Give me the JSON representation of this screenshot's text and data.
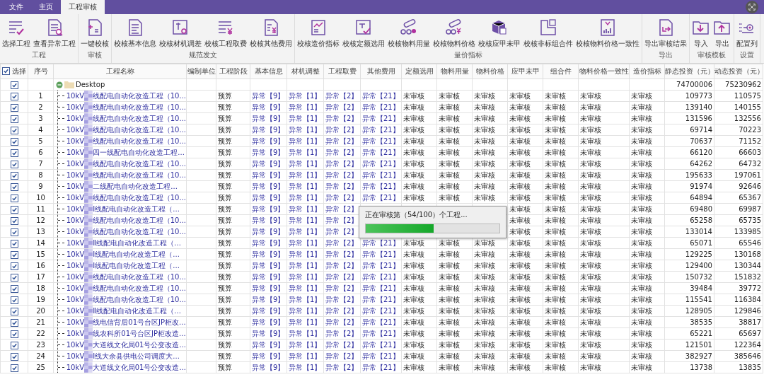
{
  "tabs": [
    {
      "label": "文件",
      "selected": false
    },
    {
      "label": "主页",
      "selected": false
    },
    {
      "label": "工程审核",
      "selected": true
    }
  ],
  "ribbon_groups": [
    {
      "label": "工程",
      "buttons": [
        "选择工程",
        "查看异常工程"
      ]
    },
    {
      "label": "审核",
      "buttons": [
        "一键校核"
      ]
    },
    {
      "label": "规范发文",
      "buttons": [
        "校核基本信息",
        "校核材机调差",
        "校核工程取费",
        "校核其他费用"
      ]
    },
    {
      "label": "量价指标",
      "buttons": [
        "校核造价指标",
        "校核定额选用",
        "校核物料用量",
        "校核物料价格",
        "校核应甲未甲",
        "校核非标组合件",
        "校核物料价格一致性"
      ]
    },
    {
      "label": "导出",
      "buttons": [
        "导出审核结果"
      ]
    },
    {
      "label": "审核模板",
      "buttons": [
        "导入",
        "导出"
      ]
    },
    {
      "label": "设置",
      "buttons": [
        "配置列"
      ]
    }
  ],
  "table": {
    "select_all": {
      "label": "选择",
      "checked": true
    },
    "columns": [
      "序号",
      "工程名称",
      "编制单位",
      "工程阶段",
      "基本信息",
      "材机调整",
      "工程取费",
      "其他费用",
      "定额选用",
      "物料用量",
      "物料价格",
      "应甲未甲",
      "组合件",
      "物料价格一致性",
      "造价指标",
      "静态投资（元）",
      "动态投资（元）"
    ],
    "root": {
      "name": "Desktop",
      "checked": true,
      "expanded": true,
      "static": "74700006",
      "dynamic": "75230962"
    },
    "rows": [
      {
        "no": "1",
        "checked": true,
        "name_start": "10kV",
        "name_rest": "线配电自动化改造工程（10...",
        "stage": "预算",
        "basic_info": "异常【9】",
        "material_adjust": "异常【1】",
        "fee": "异常【2】",
        "other_fees": "异常【21】",
        "quota": "未审核",
        "material_qty": "未审核",
        "material_price": "未审核",
        "supply": "未审核",
        "assembly": "未审核",
        "price_consistency": "未审核",
        "cost_index": "未审核",
        "static": "109773",
        "dynamic": "110575"
      },
      {
        "no": "2",
        "checked": true,
        "name_start": "10kV",
        "name_rest": "线配电自动化改造工程（10...",
        "stage": "预算",
        "basic_info": "异常【9】",
        "material_adjust": "异常【1】",
        "fee": "异常【2】",
        "other_fees": "异常【21】",
        "quota": "未审核",
        "material_qty": "未审核",
        "material_price": "未审核",
        "supply": "未审核",
        "assembly": "未审核",
        "price_consistency": "未审核",
        "cost_index": "未审核",
        "static": "139140",
        "dynamic": "140155"
      },
      {
        "no": "3",
        "checked": true,
        "name_start": "10kV",
        "name_rest": "线配电自动化改造工程（10...",
        "stage": "预算",
        "basic_info": "异常【9】",
        "material_adjust": "异常【1】",
        "fee": "异常【2】",
        "other_fees": "异常【21】",
        "quota": "未审核",
        "material_qty": "未审核",
        "material_price": "未审核",
        "supply": "未审核",
        "assembly": "未审核",
        "price_consistency": "未审核",
        "cost_index": "未审核",
        "static": "131596",
        "dynamic": "132556"
      },
      {
        "no": "4",
        "checked": true,
        "name_start": "10kV",
        "name_rest": "线配电自动化改造工程（10...",
        "stage": "预算",
        "basic_info": "异常【9】",
        "material_adjust": "异常【1】",
        "fee": "异常【2】",
        "other_fees": "异常【21】",
        "quota": "未审核",
        "material_qty": "未审核",
        "material_price": "未审核",
        "supply": "未审核",
        "assembly": "未审核",
        "price_consistency": "未审核",
        "cost_index": "未审核",
        "static": "69714",
        "dynamic": "70223"
      },
      {
        "no": "5",
        "checked": true,
        "name_start": "10kV",
        "name_rest": "线配电自动化改造工程（10...",
        "stage": "预算",
        "basic_info": "异常【9】",
        "material_adjust": "异常【1】",
        "fee": "异常【2】",
        "other_fees": "异常【21】",
        "quota": "未审核",
        "material_qty": "未审核",
        "material_price": "未审核",
        "supply": "未审核",
        "assembly": "未审核",
        "price_consistency": "未审核",
        "cost_index": "未审核",
        "static": "70637",
        "dynamic": "71152"
      },
      {
        "no": "6",
        "checked": true,
        "name_start": "10kV",
        "name_rest": "四一线配电自动化改造工程...",
        "stage": "预算",
        "basic_info": "异常【9】",
        "material_adjust": "异常【1】",
        "fee": "异常【2】",
        "other_fees": "异常【21】",
        "quota": "未审核",
        "material_qty": "未审核",
        "material_price": "未审核",
        "supply": "未审核",
        "assembly": "未审核",
        "price_consistency": "未审核",
        "cost_index": "未审核",
        "static": "66120",
        "dynamic": "66603"
      },
      {
        "no": "7",
        "checked": true,
        "name_start": "10kV",
        "name_rest": "线配电自动化改造工程（10...",
        "stage": "预算",
        "basic_info": "异常【9】",
        "material_adjust": "异常【1】",
        "fee": "异常【2】",
        "other_fees": "异常【21】",
        "quota": "未审核",
        "material_qty": "未审核",
        "material_price": "未审核",
        "supply": "未审核",
        "assembly": "未审核",
        "price_consistency": "未审核",
        "cost_index": "未审核",
        "static": "64262",
        "dynamic": "64732"
      },
      {
        "no": "8",
        "checked": true,
        "name_start": "10kV",
        "name_rest": "线配电自动化改造工程（10...",
        "stage": "预算",
        "basic_info": "异常【9】",
        "material_adjust": "异常【1】",
        "fee": "异常【2】",
        "other_fees": "异常【21】",
        "quota": "未审核",
        "material_qty": "未审核",
        "material_price": "未审核",
        "supply": "未审核",
        "assembly": "未审核",
        "price_consistency": "未审核",
        "cost_index": "未审核",
        "static": "195633",
        "dynamic": "197061"
      },
      {
        "no": "9",
        "checked": true,
        "name_start": "10kV",
        "name_rest": "二线配电自动化改造工程...",
        "stage": "预算",
        "basic_info": "异常【9】",
        "material_adjust": "异常【1】",
        "fee": "异常【2】",
        "other_fees": "异常【21】",
        "quota": "未审核",
        "material_qty": "未审核",
        "material_price": "未审核",
        "supply": "未审核",
        "assembly": "未审核",
        "price_consistency": "未审核",
        "cost_index": "未审核",
        "static": "91974",
        "dynamic": "92646"
      },
      {
        "no": "10",
        "checked": true,
        "name_start": "10kV",
        "name_rest": "线配电自动化改造工程（10...",
        "stage": "预算",
        "basic_info": "异常【9】",
        "material_adjust": "异常【1】",
        "fee": "异常【2】",
        "other_fees": "异常【21】",
        "quota": "未审核",
        "material_qty": "未审核",
        "material_price": "未审核",
        "supply": "未审核",
        "assembly": "未审核",
        "price_consistency": "未审核",
        "cost_index": "未审核",
        "static": "64894",
        "dynamic": "65367"
      },
      {
        "no": "11",
        "checked": true,
        "name_start": "10kV",
        "name_rest": "Ⅰ线配电自动化改造工程（...",
        "stage": "预算",
        "basic_info": "异常【9】",
        "material_adjust": "异常【1】",
        "fee": "异常【2】",
        "supply": "未审核",
        "assembly": "未审核",
        "price_consistency": "未审核",
        "cost_index": "未审核",
        "static": "69480",
        "dynamic": "69987"
      },
      {
        "no": "12",
        "checked": true,
        "name_start": "10kV",
        "name_rest": "线配电自动化改造工程（10...",
        "stage": "预算",
        "basic_info": "异常【9】",
        "material_adjust": "异常【1】",
        "fee": "异常【2】",
        "supply": "未审核",
        "assembly": "未审核",
        "price_consistency": "未审核",
        "cost_index": "未审核",
        "static": "65258",
        "dynamic": "65735"
      },
      {
        "no": "13",
        "checked": true,
        "name_start": "10kV",
        "name_rest": "线配电自动化改造工程（10...",
        "stage": "预算",
        "basic_info": "异常【9】",
        "material_adjust": "异常【1】",
        "fee": "异常【2】",
        "supply": "未审核",
        "assembly": "未审核",
        "price_consistency": "未审核",
        "cost_index": "未审核",
        "static": "133014",
        "dynamic": "133985"
      },
      {
        "no": "14",
        "checked": true,
        "name_start": "10kV",
        "name_rest": "Ⅱ线配电自动化改造工程（...",
        "stage": "预算",
        "basic_info": "异常【9】",
        "material_adjust": "异常【1】",
        "fee": "异常【2】",
        "other_fees": "异常【21】",
        "quota": "未审核",
        "material_qty": "未审核",
        "material_price": "未审核",
        "supply": "未审核",
        "assembly": "未审核",
        "price_consistency": "未审核",
        "cost_index": "未审核",
        "static": "65071",
        "dynamic": "65546"
      },
      {
        "no": "15",
        "checked": true,
        "name_start": "10kV",
        "name_rest": "Ⅰ线配电自动化改造工程（...",
        "stage": "预算",
        "basic_info": "异常【9】",
        "material_adjust": "异常【1】",
        "fee": "异常【2】",
        "other_fees": "异常【21】",
        "quota": "未审核",
        "material_qty": "未审核",
        "material_price": "未审核",
        "supply": "未审核",
        "assembly": "未审核",
        "price_consistency": "未审核",
        "cost_index": "未审核",
        "static": "129225",
        "dynamic": "130168"
      },
      {
        "no": "16",
        "checked": true,
        "name_start": "10kV",
        "name_rest": "Ⅰ线配电自动化改造工程（...",
        "stage": "预算",
        "basic_info": "异常【9】",
        "material_adjust": "异常【1】",
        "fee": "异常【2】",
        "other_fees": "异常【21】",
        "quota": "未审核",
        "material_qty": "未审核",
        "material_price": "未审核",
        "supply": "未审核",
        "assembly": "未审核",
        "price_consistency": "未审核",
        "cost_index": "未审核",
        "static": "129400",
        "dynamic": "130344"
      },
      {
        "no": "17",
        "checked": true,
        "name_start": "10kV",
        "name_rest": "线配电自动化改造工程（10...",
        "stage": "预算",
        "basic_info": "异常【9】",
        "material_adjust": "异常【1】",
        "fee": "异常【2】",
        "other_fees": "异常【21】",
        "quota": "未审核",
        "material_qty": "未审核",
        "material_price": "未审核",
        "supply": "未审核",
        "assembly": "未审核",
        "price_consistency": "未审核",
        "cost_index": "未审核",
        "static": "150732",
        "dynamic": "151832"
      },
      {
        "no": "18",
        "checked": true,
        "name_start": "10kV",
        "name_rest": "线配电自动化改造工程（10...",
        "stage": "预算",
        "basic_info": "异常【9】",
        "material_adjust": "异常【1】",
        "fee": "异常【2】",
        "other_fees": "异常【21】",
        "quota": "未审核",
        "material_qty": "未审核",
        "material_price": "未审核",
        "supply": "未审核",
        "assembly": "未审核",
        "price_consistency": "未审核",
        "cost_index": "未审核",
        "static": "39484",
        "dynamic": "39772"
      },
      {
        "no": "19",
        "checked": true,
        "name_start": "10kV",
        "name_rest": "线配电自动化改造工程（10...",
        "stage": "预算",
        "basic_info": "异常【9】",
        "material_adjust": "异常【1】",
        "fee": "异常【2】",
        "other_fees": "异常【21】",
        "quota": "未审核",
        "material_qty": "未审核",
        "material_price": "未审核",
        "supply": "未审核",
        "assembly": "未审核",
        "price_consistency": "未审核",
        "cost_index": "未审核",
        "static": "115541",
        "dynamic": "116384"
      },
      {
        "no": "20",
        "checked": true,
        "name_start": "10kV",
        "name_rest": "Ⅱ线配电自动化改造工程（...",
        "stage": "预算",
        "basic_info": "异常【9】",
        "material_adjust": "异常【1】",
        "fee": "异常【2】",
        "other_fees": "异常【21】",
        "quota": "未审核",
        "material_qty": "未审核",
        "material_price": "未审核",
        "supply": "未审核",
        "assembly": "未审核",
        "price_consistency": "未审核",
        "cost_index": "未审核",
        "static": "128905",
        "dynamic": "129846"
      },
      {
        "no": "21",
        "checked": true,
        "name_start": "10kV",
        "name_rest": "线电信背后01号台区JP柜改...",
        "stage": "预算",
        "basic_info": "异常【9】",
        "material_adjust": "异常【1】",
        "fee": "异常【2】",
        "other_fees": "异常【21】",
        "quota": "未审核",
        "material_qty": "未审核",
        "material_price": "未审核",
        "supply": "未审核",
        "assembly": "未审核",
        "price_consistency": "未审核",
        "cost_index": "未审核",
        "static": "38535",
        "dynamic": "38817"
      },
      {
        "no": "22",
        "checked": true,
        "name_start": "10kV",
        "name_rest": "线农科所01号台区JP柜改造...",
        "stage": "预算",
        "basic_info": "异常【9】",
        "material_adjust": "异常【1】",
        "fee": "异常【2】",
        "other_fees": "异常【21】",
        "quota": "未审核",
        "material_qty": "未审核",
        "material_price": "未审核",
        "supply": "未审核",
        "assembly": "未审核",
        "price_consistency": "未审核",
        "cost_index": "未审核",
        "static": "65221",
        "dynamic": "65697"
      },
      {
        "no": "23",
        "checked": true,
        "name_start": "10kV",
        "name_rest": "大道线文化局01号公变改造...",
        "stage": "预算",
        "basic_info": "异常【9】",
        "material_adjust": "异常【1】",
        "fee": "异常【2】",
        "other_fees": "异常【21】",
        "quota": "未审核",
        "material_qty": "未审核",
        "material_price": "未审核",
        "supply": "未审核",
        "assembly": "未审核",
        "price_consistency": "未审核",
        "cost_index": "未审核",
        "static": "121501",
        "dynamic": "122364"
      },
      {
        "no": "24",
        "checked": true,
        "name_start": "10kV",
        "name_rest": "Ⅰ线大余县供电公司调度大...",
        "stage": "预算",
        "basic_info": "异常【9】",
        "material_adjust": "异常【1】",
        "fee": "异常【2】",
        "other_fees": "异常【21】",
        "quota": "未审核",
        "material_qty": "未审核",
        "material_price": "未审核",
        "supply": "未审核",
        "assembly": "未审核",
        "price_consistency": "未审核",
        "cost_index": "未审核",
        "static": "382927",
        "dynamic": "385646"
      },
      {
        "no": "25",
        "checked": true,
        "name_start": "10kV",
        "name_rest": "大道线文化局01号公变改造...",
        "stage": "预算",
        "basic_info": "异常【9】",
        "material_adjust": "异常【1】",
        "fee": "异常【2】",
        "other_fees": "异常【21】",
        "quota": "未审核",
        "material_qty": "未审核",
        "material_price": "未审核",
        "supply": "未审核",
        "assembly": "未审核",
        "price_consistency": "未审核",
        "cost_index": "未审核",
        "static": "13738",
        "dynamic": "13835"
      }
    ]
  },
  "progress_dialog": {
    "message": "正在审核第（54/100）个工程...",
    "level": 0.51
  }
}
